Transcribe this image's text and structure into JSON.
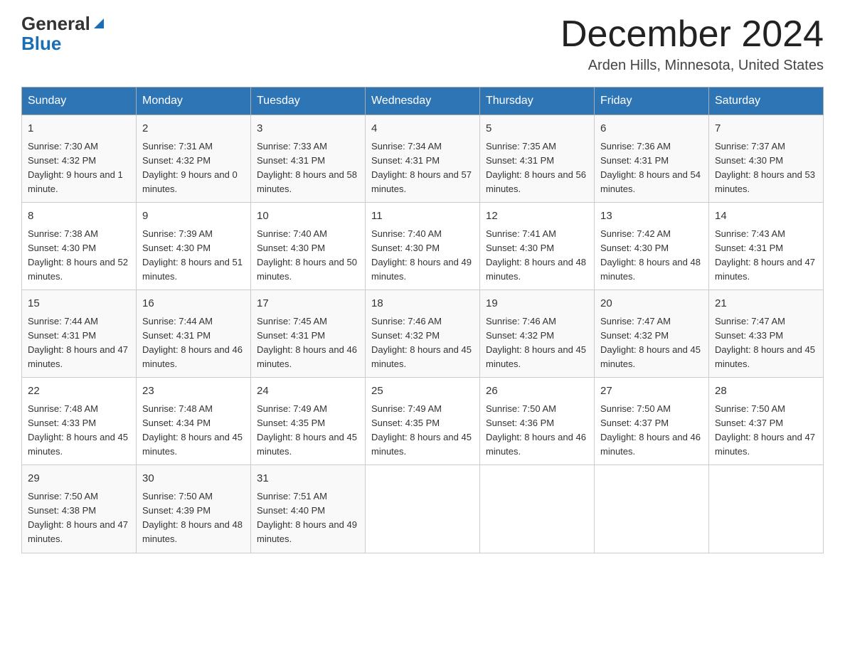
{
  "header": {
    "logo_general": "General",
    "logo_blue": "Blue",
    "title": "December 2024",
    "location": "Arden Hills, Minnesota, United States"
  },
  "calendar": {
    "days_of_week": [
      "Sunday",
      "Monday",
      "Tuesday",
      "Wednesday",
      "Thursday",
      "Friday",
      "Saturday"
    ],
    "weeks": [
      [
        {
          "day": "1",
          "sunrise": "7:30 AM",
          "sunset": "4:32 PM",
          "daylight": "9 hours and 1 minute."
        },
        {
          "day": "2",
          "sunrise": "7:31 AM",
          "sunset": "4:32 PM",
          "daylight": "9 hours and 0 minutes."
        },
        {
          "day": "3",
          "sunrise": "7:33 AM",
          "sunset": "4:31 PM",
          "daylight": "8 hours and 58 minutes."
        },
        {
          "day": "4",
          "sunrise": "7:34 AM",
          "sunset": "4:31 PM",
          "daylight": "8 hours and 57 minutes."
        },
        {
          "day": "5",
          "sunrise": "7:35 AM",
          "sunset": "4:31 PM",
          "daylight": "8 hours and 56 minutes."
        },
        {
          "day": "6",
          "sunrise": "7:36 AM",
          "sunset": "4:31 PM",
          "daylight": "8 hours and 54 minutes."
        },
        {
          "day": "7",
          "sunrise": "7:37 AM",
          "sunset": "4:30 PM",
          "daylight": "8 hours and 53 minutes."
        }
      ],
      [
        {
          "day": "8",
          "sunrise": "7:38 AM",
          "sunset": "4:30 PM",
          "daylight": "8 hours and 52 minutes."
        },
        {
          "day": "9",
          "sunrise": "7:39 AM",
          "sunset": "4:30 PM",
          "daylight": "8 hours and 51 minutes."
        },
        {
          "day": "10",
          "sunrise": "7:40 AM",
          "sunset": "4:30 PM",
          "daylight": "8 hours and 50 minutes."
        },
        {
          "day": "11",
          "sunrise": "7:40 AM",
          "sunset": "4:30 PM",
          "daylight": "8 hours and 49 minutes."
        },
        {
          "day": "12",
          "sunrise": "7:41 AM",
          "sunset": "4:30 PM",
          "daylight": "8 hours and 48 minutes."
        },
        {
          "day": "13",
          "sunrise": "7:42 AM",
          "sunset": "4:30 PM",
          "daylight": "8 hours and 48 minutes."
        },
        {
          "day": "14",
          "sunrise": "7:43 AM",
          "sunset": "4:31 PM",
          "daylight": "8 hours and 47 minutes."
        }
      ],
      [
        {
          "day": "15",
          "sunrise": "7:44 AM",
          "sunset": "4:31 PM",
          "daylight": "8 hours and 47 minutes."
        },
        {
          "day": "16",
          "sunrise": "7:44 AM",
          "sunset": "4:31 PM",
          "daylight": "8 hours and 46 minutes."
        },
        {
          "day": "17",
          "sunrise": "7:45 AM",
          "sunset": "4:31 PM",
          "daylight": "8 hours and 46 minutes."
        },
        {
          "day": "18",
          "sunrise": "7:46 AM",
          "sunset": "4:32 PM",
          "daylight": "8 hours and 45 minutes."
        },
        {
          "day": "19",
          "sunrise": "7:46 AM",
          "sunset": "4:32 PM",
          "daylight": "8 hours and 45 minutes."
        },
        {
          "day": "20",
          "sunrise": "7:47 AM",
          "sunset": "4:32 PM",
          "daylight": "8 hours and 45 minutes."
        },
        {
          "day": "21",
          "sunrise": "7:47 AM",
          "sunset": "4:33 PM",
          "daylight": "8 hours and 45 minutes."
        }
      ],
      [
        {
          "day": "22",
          "sunrise": "7:48 AM",
          "sunset": "4:33 PM",
          "daylight": "8 hours and 45 minutes."
        },
        {
          "day": "23",
          "sunrise": "7:48 AM",
          "sunset": "4:34 PM",
          "daylight": "8 hours and 45 minutes."
        },
        {
          "day": "24",
          "sunrise": "7:49 AM",
          "sunset": "4:35 PM",
          "daylight": "8 hours and 45 minutes."
        },
        {
          "day": "25",
          "sunrise": "7:49 AM",
          "sunset": "4:35 PM",
          "daylight": "8 hours and 45 minutes."
        },
        {
          "day": "26",
          "sunrise": "7:50 AM",
          "sunset": "4:36 PM",
          "daylight": "8 hours and 46 minutes."
        },
        {
          "day": "27",
          "sunrise": "7:50 AM",
          "sunset": "4:37 PM",
          "daylight": "8 hours and 46 minutes."
        },
        {
          "day": "28",
          "sunrise": "7:50 AM",
          "sunset": "4:37 PM",
          "daylight": "8 hours and 47 minutes."
        }
      ],
      [
        {
          "day": "29",
          "sunrise": "7:50 AM",
          "sunset": "4:38 PM",
          "daylight": "8 hours and 47 minutes."
        },
        {
          "day": "30",
          "sunrise": "7:50 AM",
          "sunset": "4:39 PM",
          "daylight": "8 hours and 48 minutes."
        },
        {
          "day": "31",
          "sunrise": "7:51 AM",
          "sunset": "4:40 PM",
          "daylight": "8 hours and 49 minutes."
        },
        null,
        null,
        null,
        null
      ]
    ]
  }
}
